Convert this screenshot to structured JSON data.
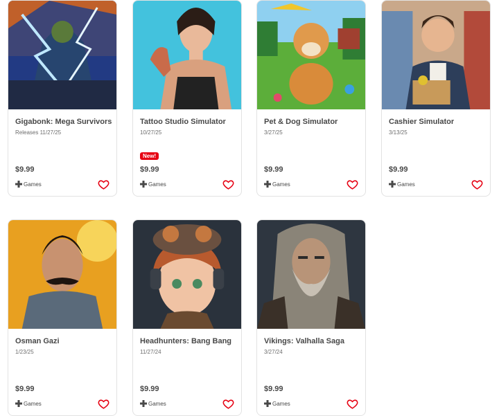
{
  "colors": {
    "accent": "#e60012",
    "text": "#484848",
    "muted": "#6d6d6d",
    "border": "#e2e2e2"
  },
  "icons": {
    "platform": "d-pad-icon",
    "wishlist": "heart-outline-icon"
  },
  "games": [
    {
      "title": "Gigabonk: Mega Survivors",
      "date": "Releases 11/27/25",
      "badge": "",
      "price": "$9.99",
      "platform": "Games"
    },
    {
      "title": "Tattoo Studio Simulator",
      "date": "10/27/25",
      "badge": "New!",
      "price": "$9.99",
      "platform": "Games"
    },
    {
      "title": "Pet & Dog Simulator",
      "date": "3/27/25",
      "badge": "",
      "price": "$9.99",
      "platform": "Games"
    },
    {
      "title": "Cashier Simulator",
      "date": "3/13/25",
      "badge": "",
      "price": "$9.99",
      "platform": "Games"
    },
    {
      "title": "Osman Gazi",
      "date": "1/23/25",
      "badge": "",
      "price": "$9.99",
      "platform": "Games"
    },
    {
      "title": "Headhunters: Bang Bang",
      "date": "11/27/24",
      "badge": "",
      "price": "$9.99",
      "platform": "Games"
    },
    {
      "title": "Vikings: Valhalla Saga",
      "date": "3/27/24",
      "badge": "",
      "price": "$9.99",
      "platform": "Games"
    }
  ]
}
